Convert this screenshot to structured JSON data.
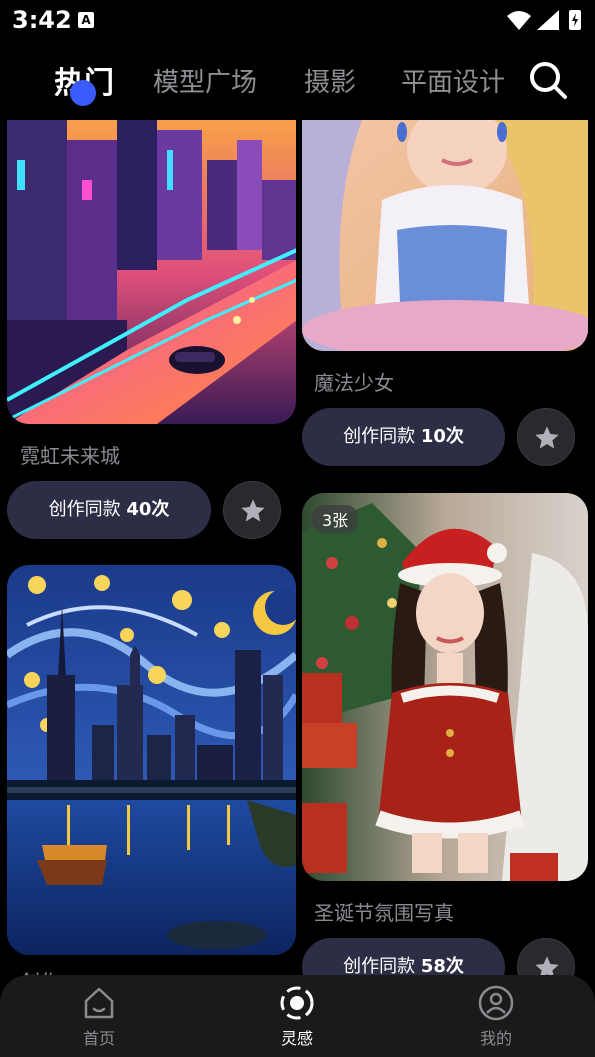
{
  "status_bar": {
    "time": "3:42",
    "notif_letter": "A"
  },
  "tabs": [
    {
      "label": "热门",
      "active": true
    },
    {
      "label": "模型广场",
      "active": false
    },
    {
      "label": "摄影",
      "active": false
    },
    {
      "label": "平面设计",
      "active": false
    }
  ],
  "cards": {
    "neon_city": {
      "caption": "霓虹未来城",
      "create_label": "创作同款",
      "count": "40次"
    },
    "magic_girl": {
      "caption": "魔法少女",
      "create_label": "创作同款",
      "count": "10次"
    },
    "starry_city": {
      "caption": "创作"
    },
    "christmas": {
      "badge": "3张",
      "caption": "圣诞节氛围写真",
      "create_label": "创作同款",
      "count": "58次"
    }
  },
  "bottom_nav": [
    {
      "label": "首页",
      "icon": "home-icon",
      "active": false
    },
    {
      "label": "灵感",
      "icon": "inspiration-icon",
      "active": true
    },
    {
      "label": "我的",
      "icon": "profile-icon",
      "active": false
    }
  ],
  "colors": {
    "accent": "#3a5cff",
    "button_bg": "#2d2d45",
    "background": "#000000"
  }
}
